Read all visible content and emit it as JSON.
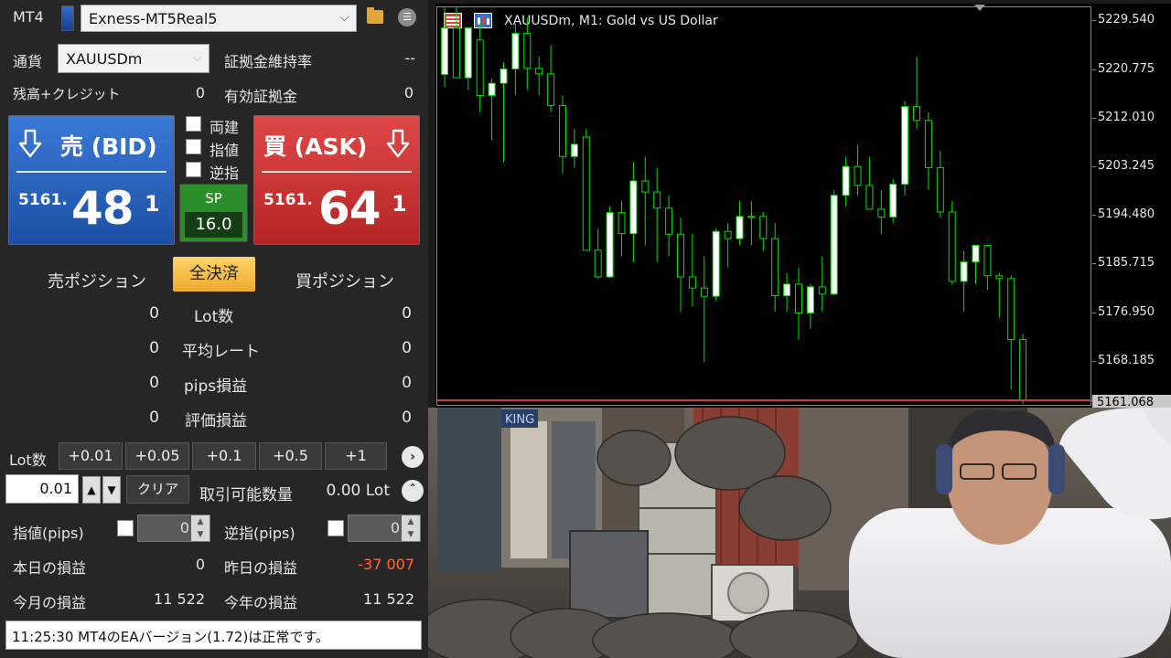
{
  "panel": {
    "platform": "MT4",
    "account": "Exness-MT5Real5",
    "currency_label": "通貨",
    "symbol": "XAUUSDm",
    "margin_level_label": "証拠金維持率",
    "margin_level_value": "--",
    "balance_label": "残高+クレジット",
    "balance_value": "0",
    "equity_label": "有効証拠金",
    "equity_value": "0"
  },
  "bid": {
    "label": "売 (BID)",
    "price_prefix": "5161.",
    "price_main": "48",
    "price_sup": "1"
  },
  "ask": {
    "label": "買 (ASK)",
    "price_prefix": "5161.",
    "price_main": "64",
    "price_sup": "1"
  },
  "options": {
    "hedge": "両建",
    "limit": "指値",
    "stop": "逆指"
  },
  "spread": {
    "label": "SP",
    "value": "16.0"
  },
  "positions": {
    "sell_label": "売ポジション",
    "close_all": "全決済",
    "buy_label": "買ポジション",
    "rows": [
      {
        "label": "Lot数",
        "sell": "0",
        "buy": "0"
      },
      {
        "label": "平均レート",
        "sell": "0",
        "buy": "0"
      },
      {
        "label": "pips損益",
        "sell": "0",
        "buy": "0"
      },
      {
        "label": "評価損益",
        "sell": "0",
        "buy": "0"
      }
    ]
  },
  "lot": {
    "label": "Lot数",
    "presets": [
      "+0.01",
      "+0.05",
      "+0.1",
      "+0.5",
      "+1"
    ],
    "value": "0.01",
    "clear": "クリア",
    "tradable_label": "取引可能数量",
    "tradable_value": "0.00 Lot"
  },
  "pips": {
    "limit_label": "指値(pips)",
    "limit_value": "0",
    "stop_label": "逆指(pips)",
    "stop_value": "0"
  },
  "pnl": {
    "today_label": "本日の損益",
    "today_value": "0",
    "yesterday_label": "昨日の損益",
    "yesterday_value": "-37 007",
    "month_label": "今月の損益",
    "month_value": "11 522",
    "year_label": "今年の損益",
    "year_value": "11 522"
  },
  "status": "11:25:30 MT4のEAバージョン(1.72)は正常です。",
  "chart_data": {
    "type": "candlestick",
    "title": "XAUUSDm, M1:  Gold vs US Dollar",
    "y_ticks": [
      "5229.540",
      "5220.775",
      "5212.010",
      "5203.245",
      "5194.480",
      "5185.715",
      "5176.950",
      "5168.185"
    ],
    "last_price": "5161.068",
    "ylim": [
      5160.4,
      5231.9
    ],
    "bull_color": "#ffffff",
    "bear_color": "#000000",
    "wick_color": "#00e000",
    "candles": [
      [
        5219.8,
        5232.0,
        5217.5,
        5228.2
      ],
      [
        5228.2,
        5231.9,
        5225.0,
        5219.2
      ],
      [
        5219.2,
        5224.0,
        5217.0,
        5228.2
      ],
      [
        5226.0,
        5229.0,
        5213.0,
        5216.0
      ],
      [
        5216.0,
        5219.0,
        5208.0,
        5218.2
      ],
      [
        5218.2,
        5222.0,
        5204.0,
        5220.8
      ],
      [
        5220.8,
        5229.0,
        5216.0,
        5227.2
      ],
      [
        5227.2,
        5230.0,
        5217.0,
        5220.9
      ],
      [
        5220.9,
        5223.0,
        5216.0,
        5219.9
      ],
      [
        5219.9,
        5225.0,
        5213.0,
        5214.2
      ],
      [
        5214.2,
        5216.0,
        5202.0,
        5205.0
      ],
      [
        5205.0,
        5210.0,
        5203.0,
        5207.2
      ],
      [
        5208.5,
        5210.0,
        5188.0,
        5188.1
      ],
      [
        5188.1,
        5192.0,
        5183.0,
        5183.3
      ],
      [
        5183.3,
        5196.0,
        5183.0,
        5194.9
      ],
      [
        5194.9,
        5197.0,
        5187.0,
        5191.1
      ],
      [
        5191.1,
        5204.0,
        5186.0,
        5200.6
      ],
      [
        5200.6,
        5205.0,
        5189.0,
        5198.6
      ],
      [
        5198.6,
        5203.0,
        5186.0,
        5195.7
      ],
      [
        5195.7,
        5198.0,
        5187.0,
        5191.0
      ],
      [
        5191.0,
        5194.0,
        5177.0,
        5183.3
      ],
      [
        5183.3,
        5191.0,
        5178.0,
        5181.3
      ],
      [
        5181.3,
        5187.0,
        5168.0,
        5179.8
      ],
      [
        5179.8,
        5192.0,
        5179.0,
        5191.5
      ],
      [
        5191.5,
        5193.0,
        5185.0,
        5190.2
      ],
      [
        5190.2,
        5197.0,
        5189.0,
        5194.2
      ],
      [
        5194.2,
        5197.0,
        5189.0,
        5194.2
      ],
      [
        5194.2,
        5195.0,
        5188.0,
        5190.2
      ],
      [
        5190.2,
        5193.0,
        5177.0,
        5179.9
      ],
      [
        5179.9,
        5184.0,
        5177.0,
        5182.0
      ],
      [
        5182.0,
        5185.0,
        5172.0,
        5176.8
      ],
      [
        5176.8,
        5182.0,
        5174.0,
        5181.5
      ],
      [
        5181.5,
        5187.0,
        5177.0,
        5180.2
      ],
      [
        5180.2,
        5199.0,
        5180.0,
        5198.0
      ],
      [
        5198.0,
        5205.0,
        5196.0,
        5203.2
      ],
      [
        5203.2,
        5207.0,
        5198.0,
        5199.8
      ],
      [
        5199.8,
        5205.0,
        5197.0,
        5195.5
      ],
      [
        5195.5,
        5199.0,
        5191.0,
        5194.1
      ],
      [
        5194.1,
        5201.0,
        5193.0,
        5200.0
      ],
      [
        5200.0,
        5215.0,
        5198.0,
        5214.0
      ],
      [
        5214.0,
        5223.0,
        5210.0,
        5211.5
      ],
      [
        5211.5,
        5213.0,
        5199.0,
        5203.0
      ],
      [
        5203.0,
        5206.0,
        5194.0,
        5195.0
      ],
      [
        5195.0,
        5197.0,
        5182.0,
        5182.5
      ],
      [
        5182.5,
        5188.0,
        5177.0,
        5186.0
      ],
      [
        5186.0,
        5189.0,
        5182.0,
        5189.0
      ],
      [
        5189.0,
        5188.0,
        5181.0,
        5183.5
      ],
      [
        5183.5,
        5184.0,
        5176.0,
        5183.0
      ],
      [
        5183.0,
        5183.5,
        5163.0,
        5172.0
      ],
      [
        5172.0,
        5173.0,
        5160.4,
        5161.1
      ]
    ]
  },
  "photo": {
    "sign_text": "KING"
  }
}
